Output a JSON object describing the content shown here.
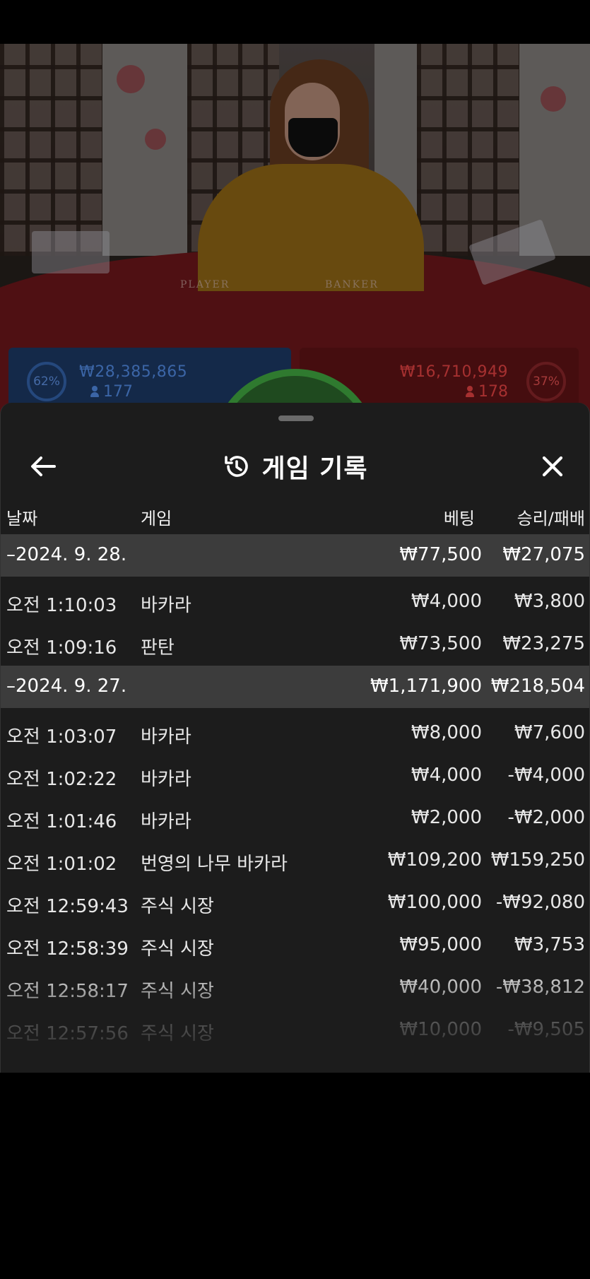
{
  "video": {
    "table_labels": [
      "PLAYER",
      "BANKER"
    ],
    "player": {
      "percent": "62%",
      "amount": "₩28,385,865",
      "count": "177"
    },
    "banker": {
      "percent": "37%",
      "amount": "₩16,710,949",
      "count": "178"
    }
  },
  "sheet": {
    "title": "게임 기록",
    "back_icon": "arrow-left-icon",
    "close_icon": "close-icon",
    "title_icon": "history-icon",
    "columns": {
      "date": "날짜",
      "game": "게임",
      "bet": "베팅",
      "win_loss": "승리/패배"
    },
    "groups": [
      {
        "date": "–2024. 9. 28.",
        "bet_total": "₩77,500",
        "win_total": "₩27,075",
        "rows": [
          {
            "time": "오전 1:10:03",
            "game": "바카라",
            "bet": "₩4,000",
            "win": "₩3,800"
          },
          {
            "time": "오전 1:09:16",
            "game": "판탄",
            "bet": "₩73,500",
            "win": "₩23,275"
          }
        ]
      },
      {
        "date": "–2024. 9. 27.",
        "bet_total": "₩1,171,900",
        "win_total": "₩218,504",
        "rows": [
          {
            "time": "오전 1:03:07",
            "game": "바카라",
            "bet": "₩8,000",
            "win": "₩7,600"
          },
          {
            "time": "오전 1:02:22",
            "game": "바카라",
            "bet": "₩4,000",
            "win": "-₩4,000"
          },
          {
            "time": "오전 1:01:46",
            "game": "바카라",
            "bet": "₩2,000",
            "win": "-₩2,000"
          },
          {
            "time": "오전 1:01:02",
            "game": "번영의 나무 바카라",
            "bet": "₩109,200",
            "win": "₩159,250"
          },
          {
            "time": "오전 12:59:43",
            "game": "주식 시장",
            "bet": "₩100,000",
            "win": "-₩92,080"
          },
          {
            "time": "오전 12:58:39",
            "game": "주식 시장",
            "bet": "₩95,000",
            "win": "₩3,753"
          },
          {
            "time": "오전 12:58:17",
            "game": "주식 시장",
            "bet": "₩40,000",
            "win": "-₩38,812"
          },
          {
            "time": "오전 12:57:56",
            "game": "주식 시장",
            "bet": "₩10,000",
            "win": "-₩9,505"
          }
        ]
      }
    ]
  }
}
